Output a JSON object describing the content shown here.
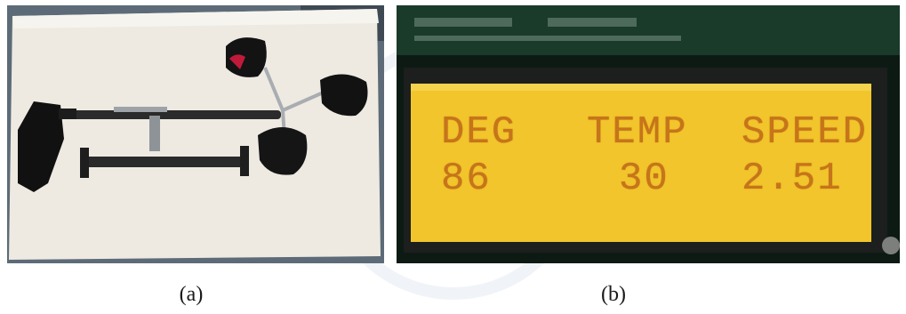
{
  "figure": {
    "panel_a": {
      "caption": "(a)",
      "description_colors": {
        "board": "#eeeae2",
        "cups": "#121212",
        "rod": "#2b2b2b",
        "background": "#5c6b77"
      }
    },
    "panel_b": {
      "caption": "(b)",
      "lcd": {
        "colors": {
          "screen": "#f1c52b",
          "text": "#c7741a",
          "bezel": "#0d1a14"
        },
        "row1": {
          "col1": "DEG",
          "col2": "TEMP",
          "col3": "SPEED"
        },
        "row2": {
          "col1": "86",
          "col2": "30",
          "col3": "2.51"
        }
      }
    }
  }
}
